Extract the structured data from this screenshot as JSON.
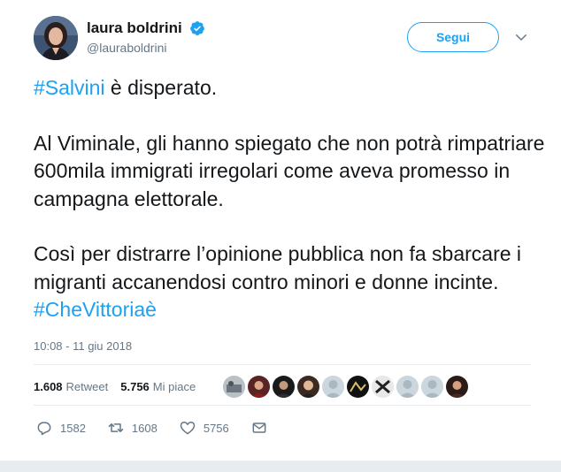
{
  "author": {
    "name": "laura boldrini",
    "handle": "@lauraboldrini",
    "verified": true,
    "avatar_icon": "profile-photo"
  },
  "follow_label": "Segui",
  "tweet": {
    "para1_tag": "#Salvini",
    "para1_text": " è disperato.",
    "para2_text": "Al Viminale, gli hanno spiegato che non potrà rimpatriare 600mila immigrati irregolari come aveva promesso in campagna elettorale.",
    "para3_text": "Così per distrarre l’opinione pubblica non fa sbarcare i migranti accanendosi contro minori e donne incinte. ",
    "para3_tag": "#CheVittoriaè",
    "timestamp": "10:08 - 11 giu 2018"
  },
  "stats": {
    "retweets_count": "1.608",
    "retweets_label": "Retweet",
    "likes_count": "5.756",
    "likes_label": "Mi piace"
  },
  "actions": {
    "replies": "1582",
    "retweets": "1608",
    "likes": "5756"
  },
  "colors": {
    "link": "#1da1f2",
    "muted": "#657786",
    "divider": "#e6ecf0"
  }
}
